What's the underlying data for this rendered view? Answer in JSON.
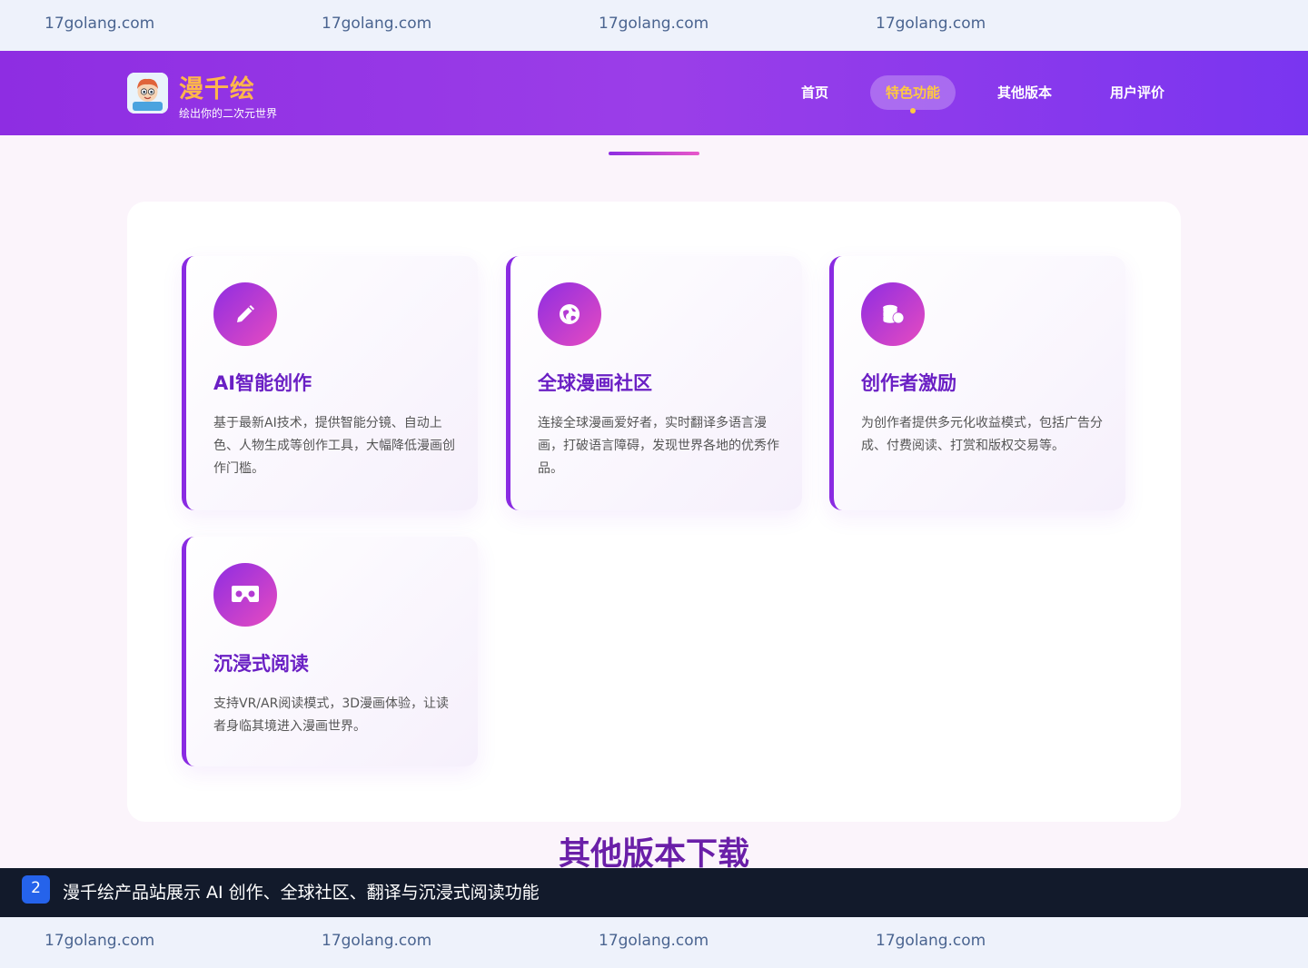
{
  "watermark": {
    "text": "17golang.com"
  },
  "header": {
    "brand_name": "漫千绘",
    "slogan": "绘出你的二次元世界",
    "nav": [
      {
        "label": "首页",
        "active": false
      },
      {
        "label": "特色功能",
        "active": true
      },
      {
        "label": "其他版本",
        "active": false
      },
      {
        "label": "用户评价",
        "active": false
      }
    ]
  },
  "features": [
    {
      "icon": "pen-icon",
      "title": "AI智能创作",
      "desc": "基于最新AI技术，提供智能分镜、自动上色、人物生成等创作工具，大幅降低漫画创作门槛。"
    },
    {
      "icon": "globe-icon",
      "title": "全球漫画社区",
      "desc": "连接全球漫画爱好者，实时翻译多语言漫画，打破语言障碍，发现世界各地的优秀作品。"
    },
    {
      "icon": "coins-icon",
      "title": "创作者激励",
      "desc": "为创作者提供多元化收益模式，包括广告分成、付费阅读、打赏和版权交易等。"
    },
    {
      "icon": "vr-headset-icon",
      "title": "沉浸式阅读",
      "desc": "支持VR/AR阅读模式，3D漫画体验，让读者身临其境进入漫画世界。"
    }
  ],
  "section_heading": "其他版本下载",
  "caption": {
    "number": "2",
    "text": "漫千绘产品站展示 AI 创作、全球社区、翻译与沉浸式阅读功能"
  },
  "colors": {
    "header_gradient_start": "#8e2de2",
    "header_gradient_end": "#7a35f0",
    "accent_yellow": "#ffc940",
    "title_purple": "#6a1fc4",
    "caption_bg": "#121a2b",
    "caption_badge": "#2563eb"
  }
}
